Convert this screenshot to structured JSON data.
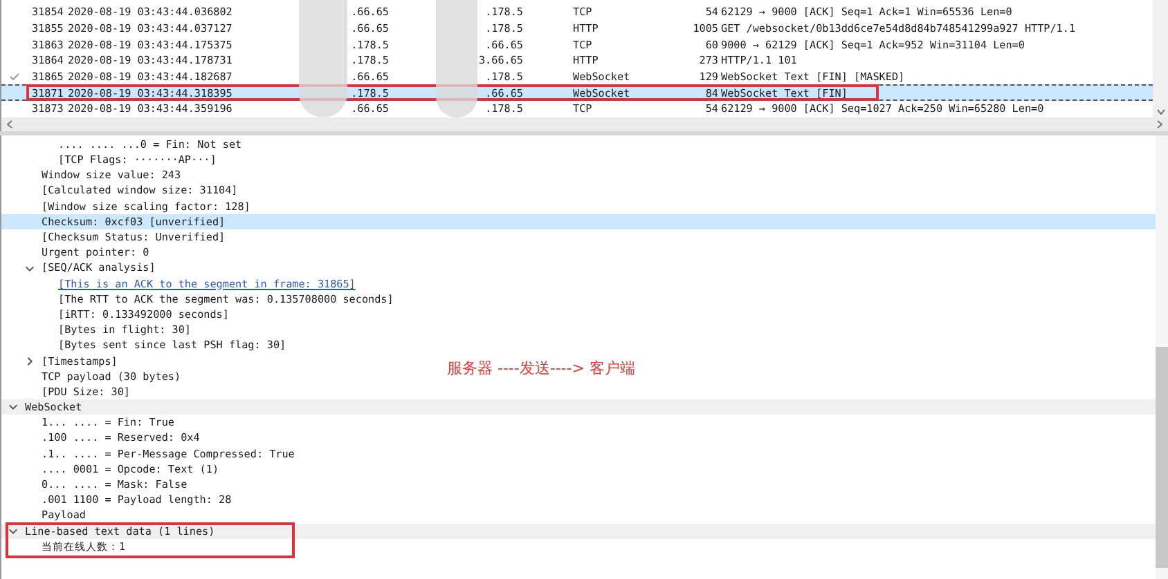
{
  "packet_list": {
    "rows": [
      {
        "no": "31854",
        "time": "2020-08-19 03:43:44.036802",
        "source": ".66.65",
        "destination": ".178.5",
        "protocol": "TCP",
        "length": "54",
        "info": "62129 → 9000 [ACK] Seq=1 Ack=1 Win=65536 Len=0",
        "selected": false,
        "related": false,
        "annotated": false
      },
      {
        "no": "31855",
        "time": "2020-08-19 03:43:44.037127",
        "source": ".66.65",
        "destination": ".178.5",
        "protocol": "HTTP",
        "length": "1005",
        "info": "GET /websocket/0b13dd6ce7e54d8d84b748541299a927 HTTP/1.1",
        "selected": false,
        "related": false,
        "annotated": false
      },
      {
        "no": "31863",
        "time": "2020-08-19 03:43:44.175375",
        "source": ".178.5",
        "destination": ".66.65",
        "protocol": "TCP",
        "length": "60",
        "info": "9000 → 62129 [ACK] Seq=1 Ack=952 Win=31104 Len=0",
        "selected": false,
        "related": false,
        "annotated": false
      },
      {
        "no": "31864",
        "time": "2020-08-19 03:43:44.178731",
        "source": ".178.5",
        "destination": "3.66.65",
        "protocol": "HTTP",
        "length": "273",
        "info": "HTTP/1.1 101",
        "selected": false,
        "related": false,
        "annotated": false
      },
      {
        "no": "31865",
        "time": "2020-08-19 03:43:44.182687",
        "source": ".66.65",
        "destination": ".178.5",
        "protocol": "WebSocket",
        "length": "129",
        "info": "WebSocket Text [FIN] [MASKED]",
        "selected": false,
        "related": true,
        "annotated": false
      },
      {
        "no": "31871",
        "time": "2020-08-19 03:43:44.318395",
        "source": ".178.5",
        "destination": ".66.65",
        "protocol": "WebSocket",
        "length": "84",
        "info": "WebSocket Text [FIN]",
        "selected": true,
        "related": false,
        "annotated": true
      },
      {
        "no": "31873",
        "time": "2020-08-19 03:43:44.359196",
        "source": ".66.65",
        "destination": ".178.5",
        "protocol": "TCP",
        "length": "54",
        "info": "62129 → 9000 [ACK] Seq=1027 Ack=250 Win=65280 Len=0",
        "selected": false,
        "related": false,
        "annotated": false
      }
    ]
  },
  "details": {
    "items": [
      {
        "kind": "continuation",
        "children": [
          {
            "kind": "continuation",
            "children": [
              {
                "kind": "field",
                "text": ".... .... ...0 = Fin: Not set",
                "selected": false
              },
              {
                "kind": "field",
                "text": "[TCP Flags: ·······AP···]",
                "selected": false
              }
            ]
          },
          {
            "kind": "field",
            "text": "Window size value: 243",
            "selected": false
          },
          {
            "kind": "field",
            "text": "[Calculated window size: 31104]",
            "selected": false
          },
          {
            "kind": "field",
            "text": "[Window size scaling factor: 128]",
            "selected": false
          },
          {
            "kind": "field",
            "text": "Checksum: 0xcf03 [unverified]",
            "selected": true
          },
          {
            "kind": "field",
            "text": "[Checksum Status: Unverified]",
            "selected": false
          },
          {
            "kind": "field",
            "text": "Urgent pointer: 0",
            "selected": false
          },
          {
            "kind": "field",
            "text": "[SEQ/ACK analysis]",
            "selected": false,
            "expanded": true,
            "children": [
              {
                "kind": "link",
                "text": "[This is an ACK to the segment in frame: 31865]",
                "selected": false
              },
              {
                "kind": "field",
                "text": "[The RTT to ACK the segment was: 0.135708000 seconds]",
                "selected": false
              },
              {
                "kind": "field",
                "text": "[iRTT: 0.133492000 seconds]",
                "selected": false
              },
              {
                "kind": "field",
                "text": "[Bytes in flight: 30]",
                "selected": false
              },
              {
                "kind": "field",
                "text": "[Bytes sent since last PSH flag: 30]",
                "selected": false
              }
            ]
          },
          {
            "kind": "field",
            "text": "[Timestamps]",
            "selected": false,
            "expanded": false
          },
          {
            "kind": "field",
            "text": "TCP payload (30 bytes)",
            "selected": false
          },
          {
            "kind": "field",
            "text": "[PDU Size: 30]",
            "selected": false
          }
        ]
      },
      {
        "kind": "field",
        "text": "WebSocket",
        "selected": false,
        "expanded": true,
        "children": [
          {
            "kind": "field",
            "text": "1... .... = Fin: True",
            "selected": false
          },
          {
            "kind": "field",
            "text": ".100 .... = Reserved: 0x4",
            "selected": false
          },
          {
            "kind": "field",
            "text": ".1.. .... = Per-Message Compressed: True",
            "selected": false
          },
          {
            "kind": "field",
            "text": ".... 0001 = Opcode: Text (1)",
            "selected": false
          },
          {
            "kind": "field",
            "text": "0... .... = Mask: False",
            "selected": false
          },
          {
            "kind": "field",
            "text": ".001 1100 = Payload length: 28",
            "selected": false
          },
          {
            "kind": "field",
            "text": "Payload",
            "selected": false
          }
        ]
      },
      {
        "kind": "field",
        "text": "Line-based text data (1 lines)",
        "selected": false,
        "expanded": true,
        "annotated": true,
        "children": [
          {
            "kind": "field",
            "text": "当前在线人数：1",
            "selected": false
          }
        ]
      }
    ]
  },
  "annotation": {
    "text": "服务器 ----发送----> 客户端"
  }
}
